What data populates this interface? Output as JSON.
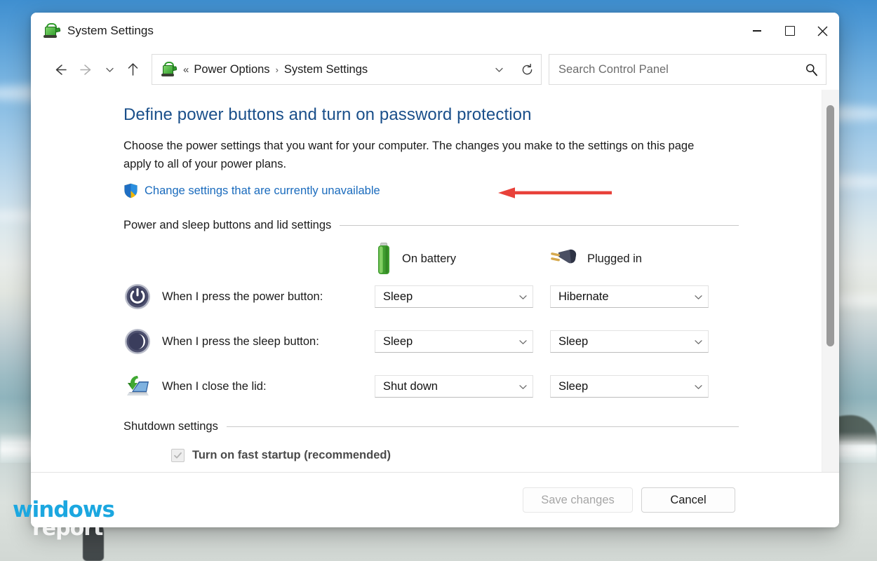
{
  "window": {
    "title": "System Settings",
    "title_icon": "power-options-icon",
    "controls": {
      "minimize": "minimize-button",
      "maximize": "maximize-button",
      "close": "close-button"
    }
  },
  "nav": {
    "back": "back-arrow-icon",
    "forward": "forward-arrow-icon",
    "recent": "chevron-down-icon",
    "up": "up-arrow-icon",
    "refresh": "refresh-icon",
    "dropdown": "chevron-down-icon"
  },
  "address": {
    "icon": "power-options-icon",
    "prefix": "«",
    "crumbs": [
      {
        "label": "Power Options"
      },
      {
        "label": "System Settings"
      }
    ],
    "separator": "›"
  },
  "search": {
    "placeholder": "Search Control Panel",
    "value": "",
    "icon": "search-icon"
  },
  "page": {
    "heading": "Define power buttons and turn on password protection",
    "description": "Choose the power settings that you want for your computer. The changes you make to the settings on this page apply to all of your power plans.",
    "uac_link": "Change settings that are currently unavailable",
    "uac_icon": "shield-icon"
  },
  "annotation": {
    "arrow": "red-left-arrow",
    "color": "#e8413a"
  },
  "sections": {
    "power_sleep": {
      "title": "Power and sleep buttons and lid settings",
      "columns": [
        {
          "label": "On battery",
          "icon": "battery-icon"
        },
        {
          "label": "Plugged in",
          "icon": "power-plug-icon"
        }
      ],
      "rows": [
        {
          "icon": "power-button-icon",
          "label": "When I press the power button:",
          "on_battery": "Sleep",
          "plugged_in": "Hibernate"
        },
        {
          "icon": "sleep-button-icon",
          "label": "When I press the sleep button:",
          "on_battery": "Sleep",
          "plugged_in": "Sleep"
        },
        {
          "icon": "laptop-lid-icon",
          "label": "When I close the lid:",
          "on_battery": "Shut down",
          "plugged_in": "Sleep"
        }
      ]
    },
    "shutdown": {
      "title": "Shutdown settings",
      "fast_startup": {
        "label": "Turn on fast startup (recommended)",
        "checked": true,
        "disabled": true
      }
    }
  },
  "footer": {
    "save_label": "Save changes",
    "cancel_label": "Cancel"
  },
  "watermark": {
    "line1": "windows",
    "line2": "report",
    "color": "#1ba7e0"
  }
}
